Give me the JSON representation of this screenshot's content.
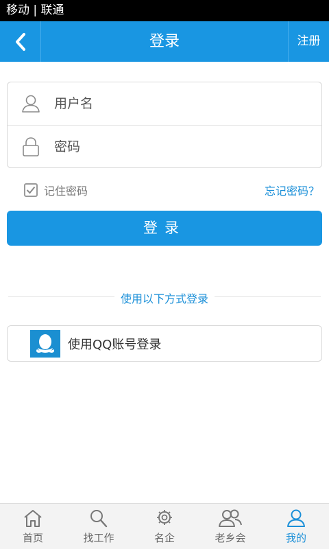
{
  "status_bar": {
    "carrier": "移动 | 联通"
  },
  "nav": {
    "back_icon": "chevron-left-icon",
    "title": "登录",
    "register": "注册"
  },
  "form": {
    "username": {
      "icon": "user-icon",
      "placeholder": "用户名",
      "value": ""
    },
    "password": {
      "icon": "lock-icon",
      "placeholder": "密码",
      "value": ""
    }
  },
  "remember": {
    "label": "记住密码",
    "checked": true
  },
  "forgot_password": "忘记密码？",
  "login_button": "登录",
  "alt_login": {
    "divider_label": "使用以下方式登录",
    "qq_label": "使用QQ账号登录",
    "qq_icon": "qq-penguin-icon"
  },
  "tabs": [
    {
      "label": "首页",
      "icon": "home-icon",
      "active": false
    },
    {
      "label": "找工作",
      "icon": "search-icon",
      "active": false
    },
    {
      "label": "名企",
      "icon": "badge-icon",
      "active": false
    },
    {
      "label": "老乡会",
      "icon": "people-icon",
      "active": false
    },
    {
      "label": "我的",
      "icon": "user-icon",
      "active": true
    }
  ],
  "colors": {
    "primary": "#1996e2",
    "link": "#1a8fd8",
    "status_bar": "#000000"
  }
}
